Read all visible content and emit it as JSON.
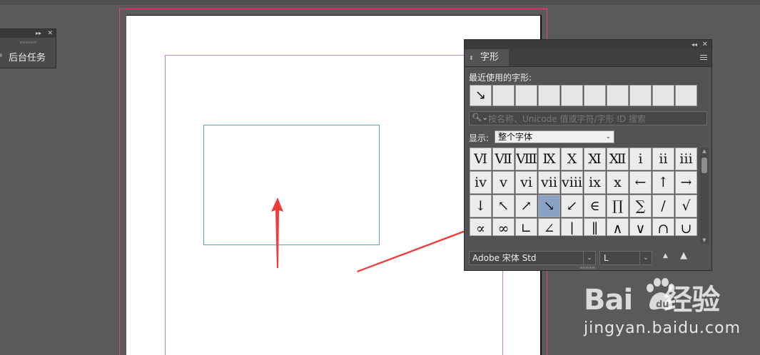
{
  "background_panel": {
    "label": "后台任务",
    "collapse_glyph": "▸▸",
    "close_glyph": "✕"
  },
  "glyphs_panel": {
    "collapse_glyph": "◂◂",
    "close_glyph": "✕",
    "tab_arrows": "⬍",
    "tab_label": "字形",
    "recent_label": "最近使用的字形:",
    "recent_glyphs": [
      "↘",
      "",
      "",
      "",
      "",
      "",
      "",
      "",
      "",
      ""
    ],
    "search_icon": "🔍︎⌄",
    "search_placeholder": "按名称、Unicode 值或字符/字形 ID 搜索",
    "show_label": "显示:",
    "show_value": "整个字体",
    "chevron_glyph": "⌄",
    "glyph_rows": [
      [
        "Ⅵ",
        "Ⅶ",
        "Ⅷ",
        "Ⅸ",
        "Ⅹ",
        "Ⅺ",
        "Ⅻ",
        "ⅰ",
        "ⅱ",
        "ⅲ"
      ],
      [
        "ⅳ",
        "ⅴ",
        "ⅵ",
        "ⅶ",
        "ⅷ",
        "ⅸ",
        "ⅹ",
        "←",
        "↑",
        "→"
      ],
      [
        "↓",
        "↖",
        "↗",
        "↘",
        "↙",
        "∈",
        "∏",
        "∑",
        "∕",
        "√"
      ],
      [
        "∝",
        "∞",
        "∟",
        "∠",
        "∣",
        "∥",
        "∧",
        "∨",
        "∩",
        "∪"
      ]
    ],
    "selected_glyph": "↘",
    "scroll_up": "▲",
    "scroll_down": "▼",
    "font_family": "Adobe 宋体 Std",
    "font_style": "L",
    "zoom_out_glyph": "▲",
    "zoom_in_glyph": "▲"
  },
  "watermark": {
    "brand": "Bai",
    "brand_suffix": "经验",
    "url": "jingyan.baidu.com"
  },
  "colors": {
    "workspace": "#5a5a5a",
    "bleed_guide": "#d24c7d",
    "margin_guide": "#b98ac6",
    "frame": "#5ba6c1",
    "annotation_arrow": "#ef3b3b",
    "selected_glyph_bg": "#8aa2c6"
  }
}
